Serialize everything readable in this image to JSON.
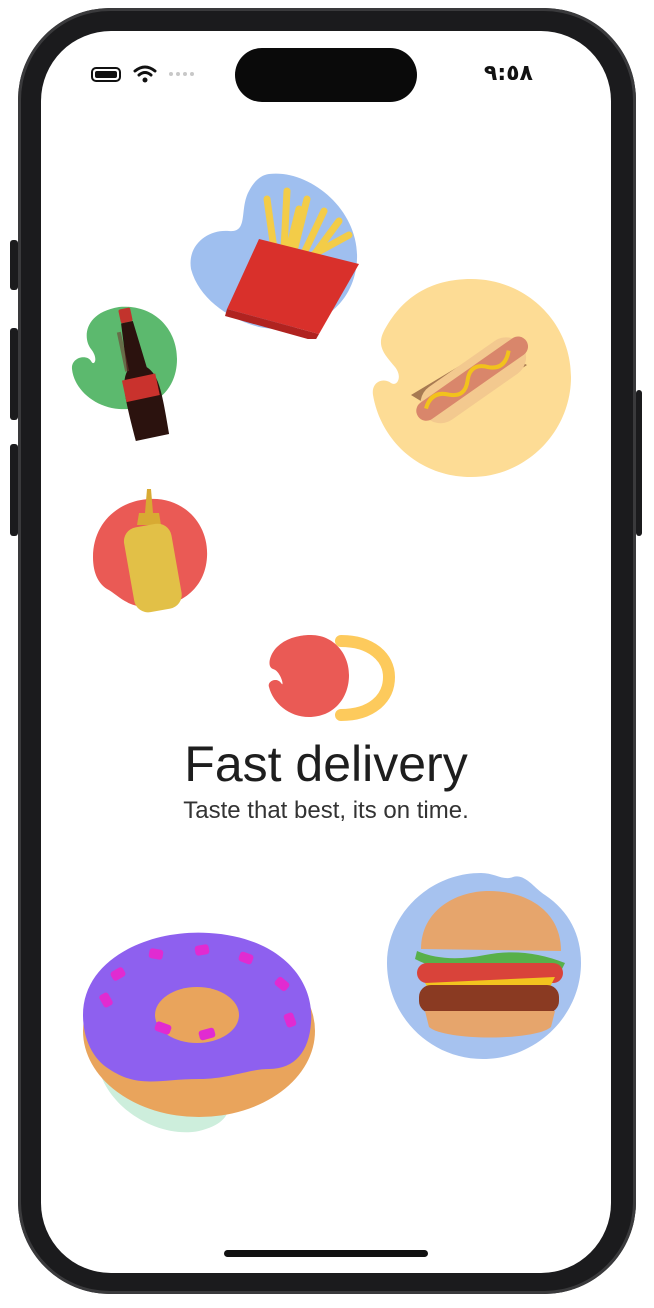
{
  "status_bar": {
    "time": "٩:٥٨"
  },
  "content": {
    "title": "Fast delivery",
    "subtitle": "Taste that best, its on time."
  },
  "illustrations": [
    {
      "name": "fries",
      "backdrop_color": "#9fbfef"
    },
    {
      "name": "cola-bottle",
      "backdrop_color": "#5cb96e"
    },
    {
      "name": "hotdog",
      "backdrop_color": "#fddc95"
    },
    {
      "name": "mustard-bottle",
      "backdrop_color": "#ea5a55"
    },
    {
      "name": "donut",
      "backdrop_color": "#cdeedc"
    },
    {
      "name": "burger",
      "backdrop_color": "#a6c2ef"
    }
  ],
  "colors": {
    "accent_red": "#ea5a55",
    "accent_yellow": "#fdca5c"
  },
  "icons": [
    "wifi-icon",
    "battery-icon",
    "brand-logo"
  ]
}
